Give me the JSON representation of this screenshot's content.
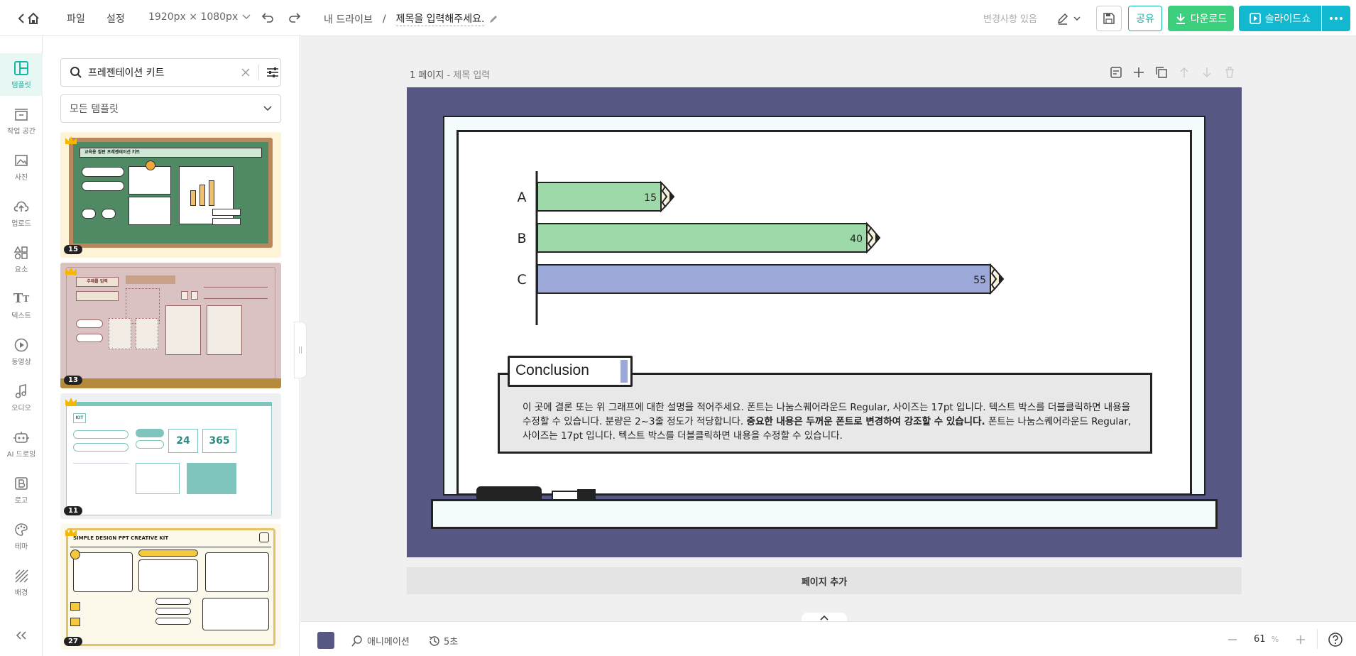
{
  "topbar": {
    "menu_file": "파일",
    "menu_settings": "설정",
    "size_label": "1920px × 1080px",
    "breadcrumb_root": "내 드라이브",
    "breadcrumb_sep": "/",
    "doc_title": "제목을 입력해주세요.",
    "status": "변경사항 있음",
    "share_label": "공유",
    "download_label": "다운로드",
    "slideshow_label": "슬라이드쇼",
    "colors": {
      "share": "#14b8a6",
      "download": "#3ccf7e",
      "slideshow": "#12b8cf"
    }
  },
  "sidebar": {
    "items": [
      {
        "label": "템플릿",
        "icon": "template-icon",
        "active": true
      },
      {
        "label": "작업 공간",
        "icon": "workspace-icon"
      },
      {
        "label": "사진",
        "icon": "photo-icon"
      },
      {
        "label": "업로드",
        "icon": "upload-icon"
      },
      {
        "label": "요소",
        "icon": "elements-icon"
      },
      {
        "label": "텍스트",
        "icon": "text-icon"
      },
      {
        "label": "동영상",
        "icon": "video-icon"
      },
      {
        "label": "오디오",
        "icon": "audio-icon"
      },
      {
        "label": "AI 드로잉",
        "icon": "ai-drawing-icon"
      },
      {
        "label": "로고",
        "icon": "logo-icon"
      },
      {
        "label": "테마",
        "icon": "theme-icon"
      },
      {
        "label": "배경",
        "icon": "background-icon"
      }
    ]
  },
  "panel": {
    "search_value": "프레젠테이션 키트",
    "filter_label": "모든 템플릿",
    "thumbnails": [
      {
        "count": "15",
        "title": "교육용 칠판 프레젠테이션 키트",
        "theme": "chalkboard"
      },
      {
        "count": "13",
        "title": "주제를 입력",
        "theme": "vintage"
      },
      {
        "count": "11",
        "title": "KIT",
        "theme": "teal"
      },
      {
        "count": "27",
        "title": "SIMPLE DESIGN PPT CREATIVE KIT",
        "theme": "yellow"
      }
    ]
  },
  "canvas": {
    "page_label": "1 페이지",
    "page_title": "제목 입력",
    "add_page": "페이지 추가",
    "slide_bg": "#575784"
  },
  "chart_data": {
    "type": "bar",
    "orientation": "horizontal",
    "categories": [
      "A",
      "B",
      "C"
    ],
    "values": [
      15,
      40,
      55
    ],
    "colors": [
      "#9ed9a9",
      "#9ed9a9",
      "#9ba8d8"
    ],
    "xlim": [
      0,
      60
    ]
  },
  "conclusion": {
    "title": "Conclusion",
    "body_1": "이 곳에 결론 또는 위 그래프에 대한 설명을 적어주세요. 폰트는 나눔스퀘어라운드 Regular, 사이즈는 17pt 입니다. 텍스트 박스를 더블클릭하면 내용을",
    "body_2": "수정할 수 있습니다. 분량은 2~3줄 정도가 적당합니다.",
    "body_bold": "중요한 내용은 두꺼운 폰트로 변경하여 강조할 수 있습니다.",
    "body_3": "폰트는 나눔스퀘어라운드 Regular,",
    "body_4": "사이즈는 17pt 입니다. 텍스트 박스를 더블클릭하면 내용을 수정할 수 있습니다."
  },
  "bottombar": {
    "color_swatch": "#575784",
    "animation_label": "애니메이션",
    "duration_label": "5초",
    "zoom_value": "61",
    "zoom_unit": "%"
  }
}
